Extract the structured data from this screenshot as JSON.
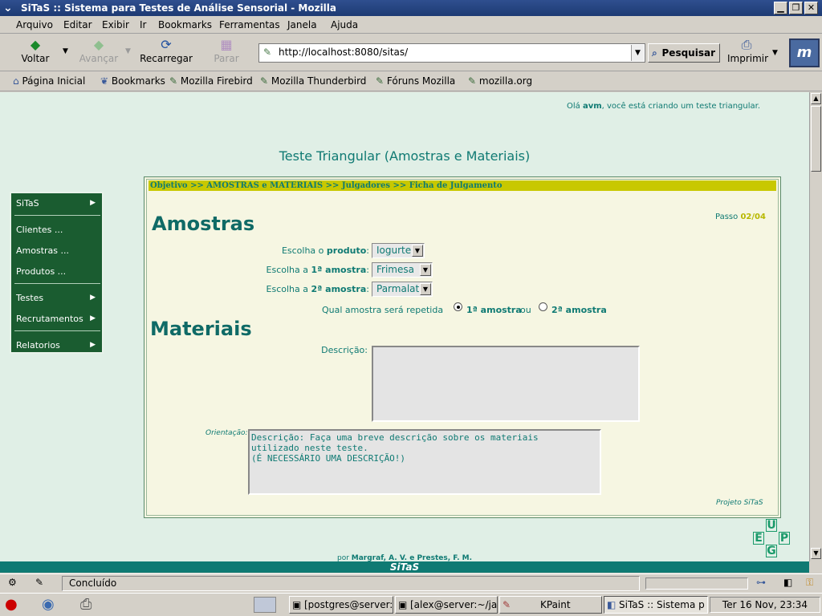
{
  "window": {
    "title": "SiTaS :: Sistema para Testes de Análise Sensorial - Mozilla"
  },
  "menu": [
    "Arquivo",
    "Editar",
    "Exibir",
    "Ir",
    "Bookmarks",
    "Ferramentas",
    "Janela",
    "Ajuda"
  ],
  "nav": {
    "back": "Voltar",
    "forward": "Avançar",
    "reload": "Recarregar",
    "stop": "Parar",
    "url": "http://localhost:8080/sitas/",
    "search": "Pesquisar",
    "print": "Imprimir"
  },
  "bookmarks": [
    "Página Inicial",
    "Bookmarks",
    "Mozilla Firebird",
    "Mozilla Thunderbird",
    "Fóruns Mozilla",
    "mozilla.org"
  ],
  "page": {
    "greeting_pre": "Olá ",
    "greeting_user": "avm",
    "greeting_post": ", você está criando um teste triangular.",
    "heading": "Teste Triangular (Amostras e Materiais)",
    "steps": "Objetivo >> AMOSTRAS e MATERIAIS >> Julgadores >> Ficha de Julgamento",
    "passo_label": "Passo ",
    "passo_value": "02/04",
    "amostras_title": "Amostras",
    "produto_label_pre": "Escolha o ",
    "produto_label_bold": "produto",
    "produto_value": "Iogurte",
    "amostra1_label_pre": "Escolha a ",
    "amostra1_label_bold": "1ª amostra",
    "amostra1_value": "Frimesa",
    "amostra2_label_pre": "Escolha a ",
    "amostra2_label_bold": "2ª amostra",
    "amostra2_value": "Parmalat",
    "repetida_label": "Qual amostra será repetida",
    "radio1": "1ª amostra",
    "radio_or": "ou",
    "radio2": "2ª amostra",
    "materiais_title": "Materiais",
    "descricao_label": "Descrição:",
    "descricao_value": "",
    "orientacao_label": "Orientação:",
    "orientacao_value": "Descrição: Faça uma breve descrição sobre os materiais\nutilizado neste teste.\n(É NECESSÁRIO UMA DESCRIÇÃO!)",
    "projeto": "Projeto SiTaS",
    "credits_pre": "por ",
    "credits_names": "Margraf, A. V. e Prestes, F. M.",
    "footer": "SiTaS"
  },
  "sidemenu": [
    {
      "label": "SiTaS",
      "arrow": true
    },
    {
      "label": "Clientes ...",
      "arrow": false
    },
    {
      "label": "Amostras ...",
      "arrow": false
    },
    {
      "label": "Produtos ...",
      "arrow": false
    },
    {
      "label": "Testes",
      "arrow": true
    },
    {
      "label": "Recrutamentos",
      "arrow": true
    },
    {
      "label": "Relatorios",
      "arrow": true
    }
  ],
  "status": {
    "text": "Concluído"
  },
  "taskbar": {
    "tasks": [
      "[postgres@server:",
      "[alex@server:~/jak",
      "KPaint",
      "SiTaS :: Sistema p"
    ],
    "clock": "Ter 16 Nov, 23:34"
  },
  "colors": {
    "teal": "#0f7a73",
    "menu_green": "#1a5c30",
    "step_bar": "#c8c800"
  }
}
